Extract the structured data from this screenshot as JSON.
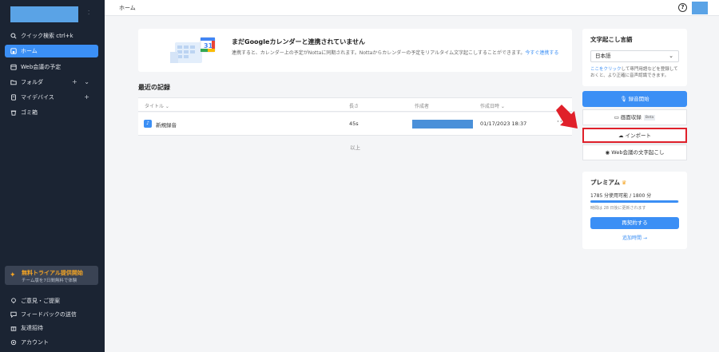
{
  "colors": {
    "sidebar_bg": "#1b2433",
    "accent": "#3b8ff5",
    "trial_accent": "#f5a524",
    "highlight_border": "#e0202a"
  },
  "sidebar": {
    "items": [
      {
        "label": "クイック検索 ctrl+k",
        "icon": "search-icon"
      },
      {
        "label": "ホーム",
        "icon": "home-icon",
        "active": true
      },
      {
        "label": "Web会議の予定",
        "icon": "calendar-icon"
      },
      {
        "label": "フォルダ",
        "icon": "folder-icon",
        "trail": "+ ⌄"
      },
      {
        "label": "マイデバイス",
        "icon": "device-icon",
        "trail": "+"
      },
      {
        "label": "ゴミ箱",
        "icon": "trash-icon"
      }
    ],
    "trial": {
      "title": "無料トライアル提供開始",
      "subtitle": "チーム版を7日間無料で体験"
    },
    "bottom_items": [
      {
        "label": "ご意見・ご提案",
        "icon": "lightbulb-icon"
      },
      {
        "label": "フィードバックの送信",
        "icon": "chat-icon"
      },
      {
        "label": "友達招待",
        "icon": "gift-icon"
      },
      {
        "label": "アカウント",
        "icon": "gear-icon"
      }
    ]
  },
  "header": {
    "breadcrumb": "ホーム"
  },
  "gcal": {
    "title": "まだGoogleカレンダーと連携されていません",
    "desc": "連携すると、カレンダー上の予定がNottaに同期されます。Nottaからカレンダーの予定をリアルタイム文字起こしすることができます。",
    "link": "今すぐ連携する"
  },
  "records": {
    "heading": "最近の記録",
    "columns": {
      "title": "タイトル ⌄",
      "length": "長さ",
      "creator": "作成者",
      "created": "作成日時 ⌄"
    },
    "rows": [
      {
        "title": "新規録音",
        "length": "45s",
        "created": "01/17/2023 18:37"
      }
    ],
    "end": "以上"
  },
  "lang_panel": {
    "title": "文字起こし言語",
    "selected": "日本語",
    "note_link": "ここをクリック",
    "note": "して専門用語などを登録しておくと、より正確に音声認識できます。"
  },
  "actions": {
    "record": "録音開始",
    "screen": "画面収録",
    "beta": "Beta",
    "import": "インポート",
    "web": "Web会議の文字起こし"
  },
  "premium": {
    "title": "プレミアム",
    "usage": "1785 分使用可能 / 1800 分",
    "usage_fraction": 0.99,
    "reset": "時間は 28 日後に更新されます",
    "renew": "再契約する",
    "extra": "追加時間 →"
  }
}
